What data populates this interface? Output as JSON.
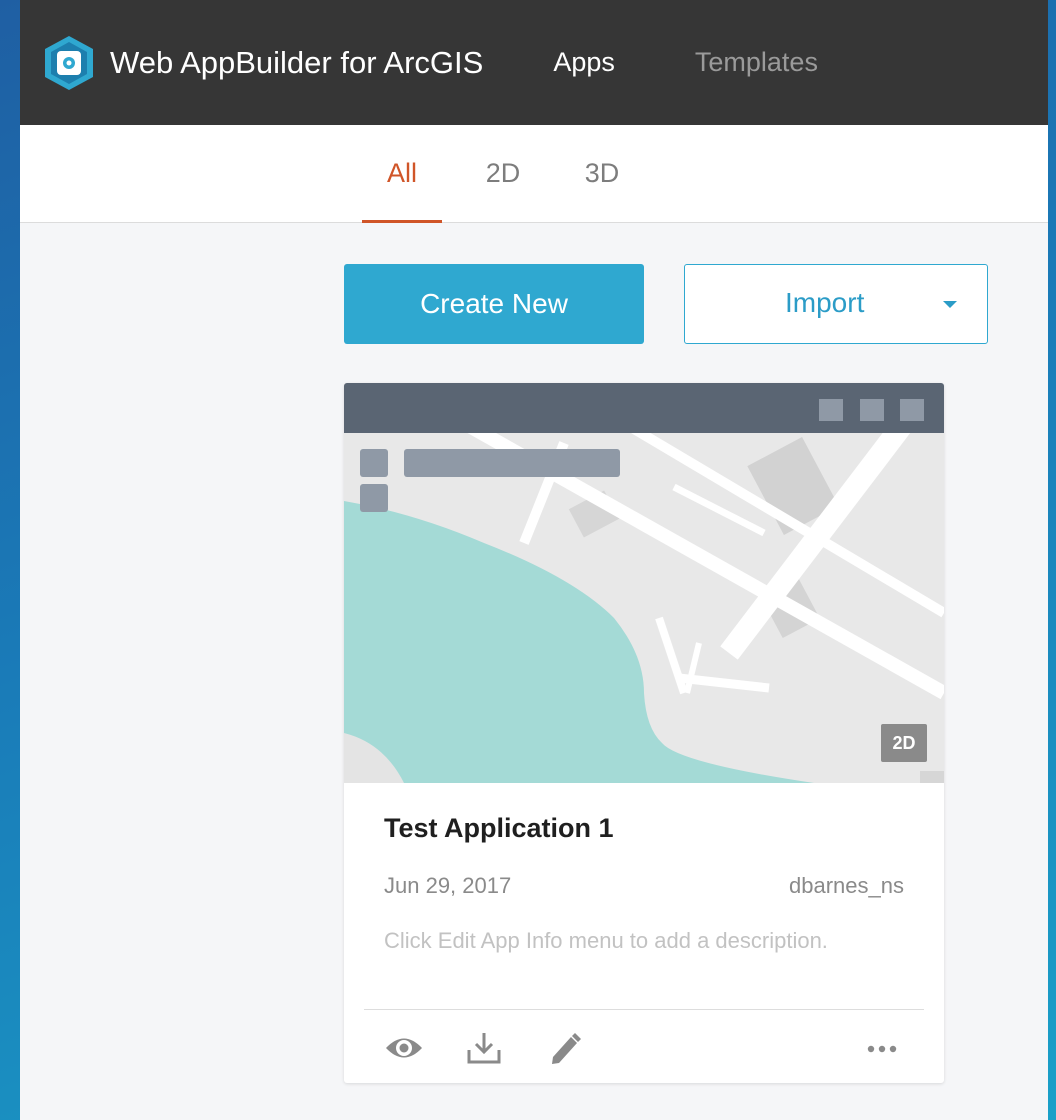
{
  "header": {
    "app_title": "Web AppBuilder for ArcGIS",
    "nav": [
      {
        "label": "Apps"
      },
      {
        "label": "Templates"
      }
    ]
  },
  "tabs": [
    {
      "label": "All",
      "active": true
    },
    {
      "label": "2D",
      "active": false
    },
    {
      "label": "3D",
      "active": false
    }
  ],
  "actions": {
    "create_label": "Create New",
    "import_label": "Import"
  },
  "app_card": {
    "title": "Test Application 1",
    "date": "Jun 29, 2017",
    "owner": "dbarnes_ns",
    "description": "Click Edit App Info menu to add a description.",
    "badge": "2D",
    "action_icons": [
      "eye-icon",
      "download-icon",
      "pencil-icon",
      "more-icon"
    ]
  },
  "colors": {
    "header_bg": "#363636",
    "accent_tab": "#d05528",
    "primary_button": "#2fa8d0",
    "water": "#a4dad6",
    "land": "#e6e6e6",
    "thumb_toolbar": "#5a6573"
  }
}
